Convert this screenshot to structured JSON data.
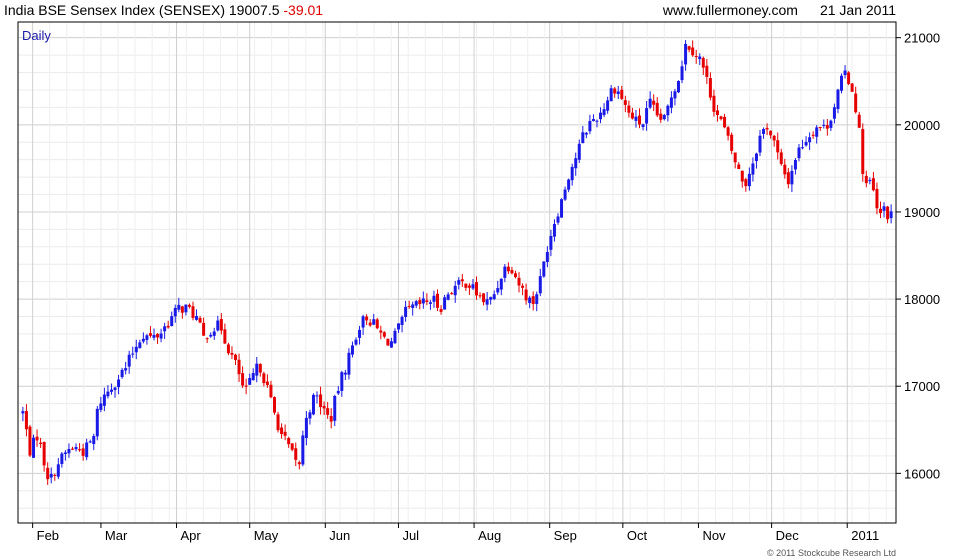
{
  "header": {
    "instrument": "India BSE Sensex Index (SENSEX)",
    "last": "19007.5",
    "change": "-39.01",
    "site": "www.fullermoney.com",
    "date": "21 Jan 2011"
  },
  "period_label": "Daily",
  "copyright": "© 2011 Stockcube Research Ltd",
  "colors": {
    "up": "#1a1ae6",
    "down": "#e60000",
    "grid": "#dddddd",
    "axis": "#000000"
  },
  "chart_data": {
    "type": "candlestick",
    "y_ticks": [
      16000,
      17000,
      18000,
      19000,
      20000,
      21000
    ],
    "ylim": [
      15430,
      21180
    ],
    "x_ticks": [
      {
        "label": "Feb",
        "day": 0
      },
      {
        "label": "Mar",
        "day": 28
      },
      {
        "label": "Apr",
        "day": 59
      },
      {
        "label": "May",
        "day": 89
      },
      {
        "label": "Jun",
        "day": 120
      },
      {
        "label": "Jul",
        "day": 150
      },
      {
        "label": "Aug",
        "day": 181
      },
      {
        "label": "Sep",
        "day": 212
      },
      {
        "label": "Oct",
        "day": 242
      },
      {
        "label": "Nov",
        "day": 273
      },
      {
        "label": "Dec",
        "day": 303
      },
      {
        "label": "2011",
        "day": 334
      }
    ],
    "xlim": [
      -6,
      354
    ],
    "close_path": [
      [
        -4,
        16700
      ],
      [
        -1,
        16250
      ],
      [
        2,
        16450
      ],
      [
        5,
        16100
      ],
      [
        7,
        15900
      ],
      [
        10,
        16100
      ],
      [
        14,
        16250
      ],
      [
        17,
        16300
      ],
      [
        21,
        16250
      ],
      [
        25,
        16400
      ],
      [
        27,
        16800
      ],
      [
        31,
        16950
      ],
      [
        35,
        17100
      ],
      [
        38,
        17200
      ],
      [
        42,
        17450
      ],
      [
        45,
        17600
      ],
      [
        49,
        17550
      ],
      [
        52,
        17600
      ],
      [
        56,
        17750
      ],
      [
        60,
        17900
      ],
      [
        63,
        17900
      ],
      [
        67,
        17800
      ],
      [
        70,
        17550
      ],
      [
        73,
        17650
      ],
      [
        77,
        17700
      ],
      [
        80,
        17450
      ],
      [
        84,
        17200
      ],
      [
        87,
        16900
      ],
      [
        90,
        17100
      ],
      [
        93,
        17250
      ],
      [
        96,
        17000
      ],
      [
        99,
        16700
      ],
      [
        102,
        16450
      ],
      [
        105,
        16300
      ],
      [
        109,
        16050
      ],
      [
        112,
        16650
      ],
      [
        116,
        16900
      ],
      [
        119,
        16750
      ],
      [
        122,
        16600
      ],
      [
        125,
        16950
      ],
      [
        128,
        17200
      ],
      [
        131,
        17450
      ],
      [
        134,
        17700
      ],
      [
        137,
        17800
      ],
      [
        140,
        17700
      ],
      [
        144,
        17550
      ],
      [
        147,
        17500
      ],
      [
        150,
        17650
      ],
      [
        153,
        17850
      ],
      [
        156,
        17900
      ],
      [
        160,
        17950
      ],
      [
        164,
        18000
      ],
      [
        167,
        17900
      ],
      [
        171,
        18100
      ],
      [
        174,
        18150
      ],
      [
        178,
        18200
      ],
      [
        181,
        18100
      ],
      [
        184,
        18000
      ],
      [
        187,
        17950
      ],
      [
        190,
        18100
      ],
      [
        193,
        18350
      ],
      [
        196,
        18400
      ],
      [
        199,
        18200
      ],
      [
        202,
        18050
      ],
      [
        205,
        17950
      ],
      [
        208,
        18200
      ],
      [
        211,
        18600
      ],
      [
        214,
        18900
      ],
      [
        217,
        19150
      ],
      [
        220,
        19450
      ],
      [
        223,
        19650
      ],
      [
        226,
        19900
      ],
      [
        229,
        20050
      ],
      [
        232,
        20100
      ],
      [
        235,
        20250
      ],
      [
        238,
        20450
      ],
      [
        241,
        20350
      ],
      [
        244,
        20150
      ],
      [
        247,
        20050
      ],
      [
        250,
        20000
      ],
      [
        253,
        20250
      ],
      [
        256,
        20100
      ],
      [
        259,
        20050
      ],
      [
        262,
        20350
      ],
      [
        265,
        20550
      ],
      [
        268,
        20950
      ],
      [
        271,
        20850
      ],
      [
        274,
        20750
      ],
      [
        277,
        20450
      ],
      [
        280,
        20150
      ],
      [
        283,
        20000
      ],
      [
        286,
        19750
      ],
      [
        289,
        19500
      ],
      [
        292,
        19300
      ],
      [
        295,
        19550
      ],
      [
        298,
        19850
      ],
      [
        301,
        20000
      ],
      [
        304,
        19800
      ],
      [
        307,
        19500
      ],
      [
        310,
        19350
      ],
      [
        313,
        19650
      ],
      [
        316,
        19800
      ],
      [
        319,
        19900
      ],
      [
        322,
        20000
      ],
      [
        325,
        19950
      ],
      [
        328,
        20150
      ],
      [
        331,
        20450
      ],
      [
        333,
        20600
      ],
      [
        335,
        20500
      ],
      [
        337,
        20300
      ],
      [
        339,
        19900
      ],
      [
        341,
        19300
      ],
      [
        343,
        19350
      ],
      [
        345,
        19200
      ],
      [
        347,
        18900
      ],
      [
        349,
        19050
      ],
      [
        351,
        18950
      ],
      [
        352,
        19007.5
      ]
    ]
  }
}
